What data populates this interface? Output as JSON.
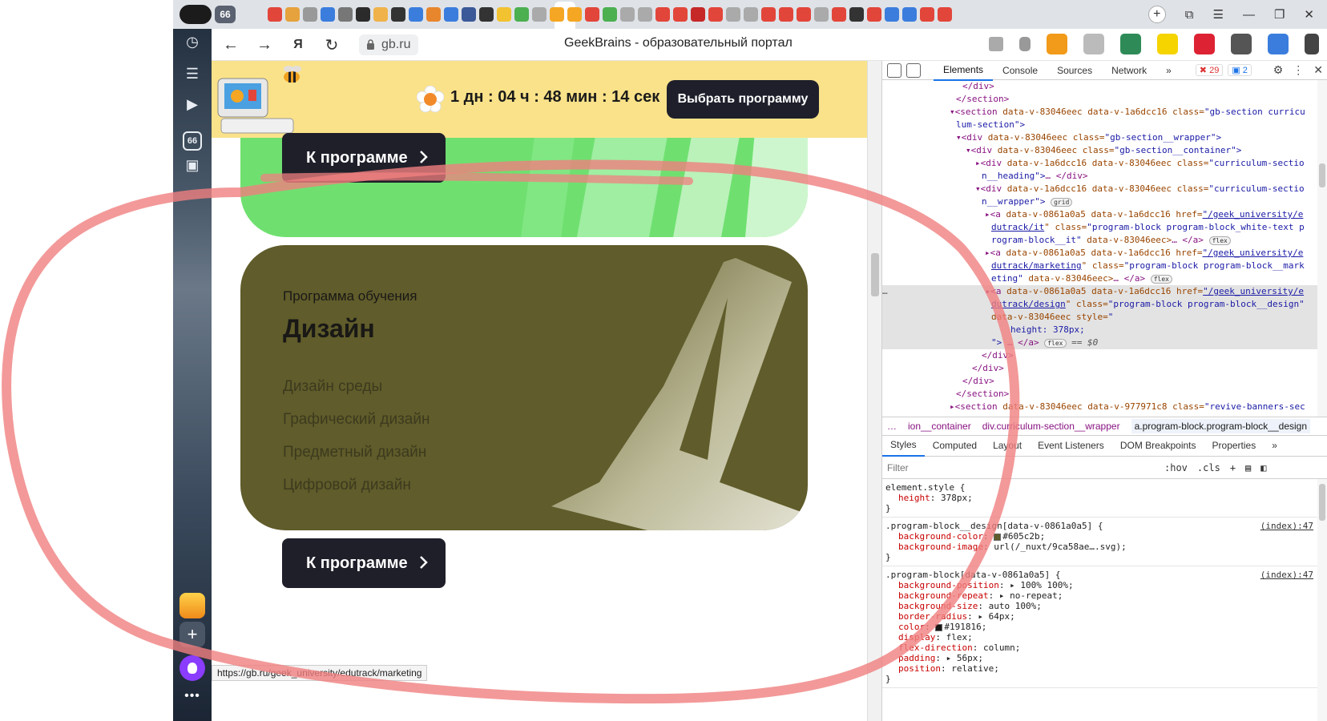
{
  "tabstrip": {
    "tab_count": "66",
    "tab_icon_colors": [
      "#e2463a",
      "#e6a23c",
      "#999999",
      "#3b7ddd",
      "#777777",
      "#2b2b2b",
      "#f0b24a",
      "#333333",
      "#3b7ddd",
      "#e8862d",
      "#3b7ddd",
      "#3b5998",
      "#333333",
      "#f2c230",
      "#4caf50",
      "#aaaaaa",
      "#f5a623",
      "#f5a623",
      "#e2463a",
      "#4caf50",
      "#aaaaaa",
      "#aaaaaa",
      "#e2463a",
      "#e2463a",
      "#c62828",
      "#e2463a",
      "#aaaaaa",
      "#aaaaaa",
      "#e2463a",
      "#e2463a",
      "#e2463a",
      "#aaaaaa",
      "#e2463a",
      "#333333",
      "#e2463a",
      "#3b7ddd",
      "#3b7ddd",
      "#e2463a",
      "#e2463a"
    ]
  },
  "navbar": {
    "url": "gb.ru",
    "title": "GeekBrains - образовательный портал"
  },
  "vsidebar": {
    "badge": "66",
    "more": "•••"
  },
  "banner": {
    "timer": "1 дн : 04 ч : 48 мин : 14 сек",
    "choose_program": "Выбрать программу"
  },
  "green_card": {
    "button": "К программе",
    "color": "#6fe070"
  },
  "design_card": {
    "kicker": "Программа обучения",
    "title": "Дизайн",
    "items": [
      "Дизайн среды",
      "Графический дизайн",
      "Предметный дизайн",
      "Цифровой дизайн"
    ],
    "button": "К программе",
    "color": "#605c2b"
  },
  "statusbar": {
    "url": "https://gb.ru/geek_university/edutrack/marketing"
  },
  "devtools": {
    "tabs": [
      "Elements",
      "Console",
      "Sources",
      "Network"
    ],
    "more": "»",
    "errors": "29",
    "messages": "2",
    "breadcrumbs": [
      "…",
      "ion__container",
      "div.curriculum-section__wrapper",
      "a.program-block.program-block__design"
    ],
    "styles_tabs": [
      "Styles",
      "Computed",
      "Layout",
      "Event Listeners",
      "DOM Breakpoints",
      "Properties",
      "»"
    ],
    "filter_placeholder": "Filter",
    "hov": ":hov",
    "cls": ".cls",
    "dom": {
      "l01": "</div>",
      "l02": "</section>",
      "l03a": "▾<section ",
      "l03b": "data-v-83046eec data-v-1a6dcc16 class=",
      "l03c": "\"gb-section curricu",
      "l04": "lum-section\">",
      "l05a": "▾<div ",
      "l05b": "data-v-83046eec class=",
      "l05c": "\"gb-section__wrapper\">",
      "l06a": "▾<div ",
      "l06b": "data-v-83046eec class=",
      "l06c": "\"gb-section__container\">",
      "l07a": "▸<div ",
      "l07b": "data-v-1a6dcc16 data-v-83046eec class=",
      "l07c": "\"curriculum-sectio",
      "l08a": "n__heading\">",
      "l08b": "… </div>",
      "l09a": "▾<div ",
      "l09b": "data-v-1a6dcc16 data-v-83046eec class=",
      "l09c": "\"curriculum-sectio",
      "l10a": "n__wrapper\">",
      "l10p": "grid",
      "l11a": "▸<a ",
      "l11b": "data-v-0861a0a5 data-v-1a6dcc16 href=",
      "l11c": "\"/geek_university/e",
      "l12a": "dutrack/it",
      "l12b": "\" class=",
      "l12c": "\"program-block program-block_white-text p",
      "l13a": "rogram-block__it\" ",
      "l13b": "data-v-83046eec>",
      "l13c": "… </a>",
      "l13p": "flex",
      "l14a": "▸<a ",
      "l14b": "data-v-0861a0a5 data-v-1a6dcc16 href=",
      "l14c": "\"/geek_university/e",
      "l15a": "dutrack/marketing",
      "l15b": "\" class=",
      "l15c": "\"program-block program-block__mark",
      "l16a": "eting\" ",
      "l16b": "data-v-83046eec>",
      "l16c": "… </a>",
      "l16p": "flex",
      "l17d": "…",
      "l17a": "▸<a ",
      "l17b": "data-v-0861a0a5 data-v-1a6dcc16 href=",
      "l17c": "\"/geek_university/e",
      "l18a": "dutrack/design",
      "l18b": "\" class=",
      "l18c": "\"program-block program-block__design\"",
      "l19a": "data-v-83046eec style=",
      "l19b": "\"",
      "l20a": "height: 378px;",
      "l21a": "\">",
      "l21b": " … </a>",
      "l21p": "flex",
      "l21c": " == $0",
      "l22": "</div>",
      "l23": "</div>",
      "l24": "</div>",
      "l25": "</section>",
      "l26a": "▸<section ",
      "l26b": "data-v-83046eec data-v-977971c8 class=",
      "l26c": "\"revive-banners-sec"
    },
    "rules": [
      {
        "selector": "element.style {",
        "source": "",
        "decls": [
          {
            "p": "height",
            "v": "378px;"
          }
        ]
      },
      {
        "selector": ".program-block__design[data-v-0861a0a5] {",
        "source": "(index):47",
        "decls": [
          {
            "p": "background-color",
            "v": "#605c2b;",
            "swatch": "#605c2b"
          },
          {
            "p": "background-image",
            "v": "url(/_nuxt/9ca58ae….svg);"
          }
        ]
      },
      {
        "selector": ".program-block[data-v-0861a0a5] {",
        "source": "(index):47",
        "decls": [
          {
            "p": "background-position",
            "v": "▸ 100% 100%;"
          },
          {
            "p": "background-repeat",
            "v": "▸ no-repeat;"
          },
          {
            "p": "background-size",
            "v": "auto 100%;"
          },
          {
            "p": "border-radius",
            "v": "▸ 64px;"
          },
          {
            "p": "color",
            "v": "#191816;",
            "swatch": "#191816"
          },
          {
            "p": "display",
            "v": "flex;"
          },
          {
            "p": "flex-direction",
            "v": "column;"
          },
          {
            "p": "padding",
            "v": "▸ 56px;"
          },
          {
            "p": "position",
            "v": "relative;"
          }
        ]
      }
    ]
  },
  "annotation": {
    "color": "#f08080"
  }
}
